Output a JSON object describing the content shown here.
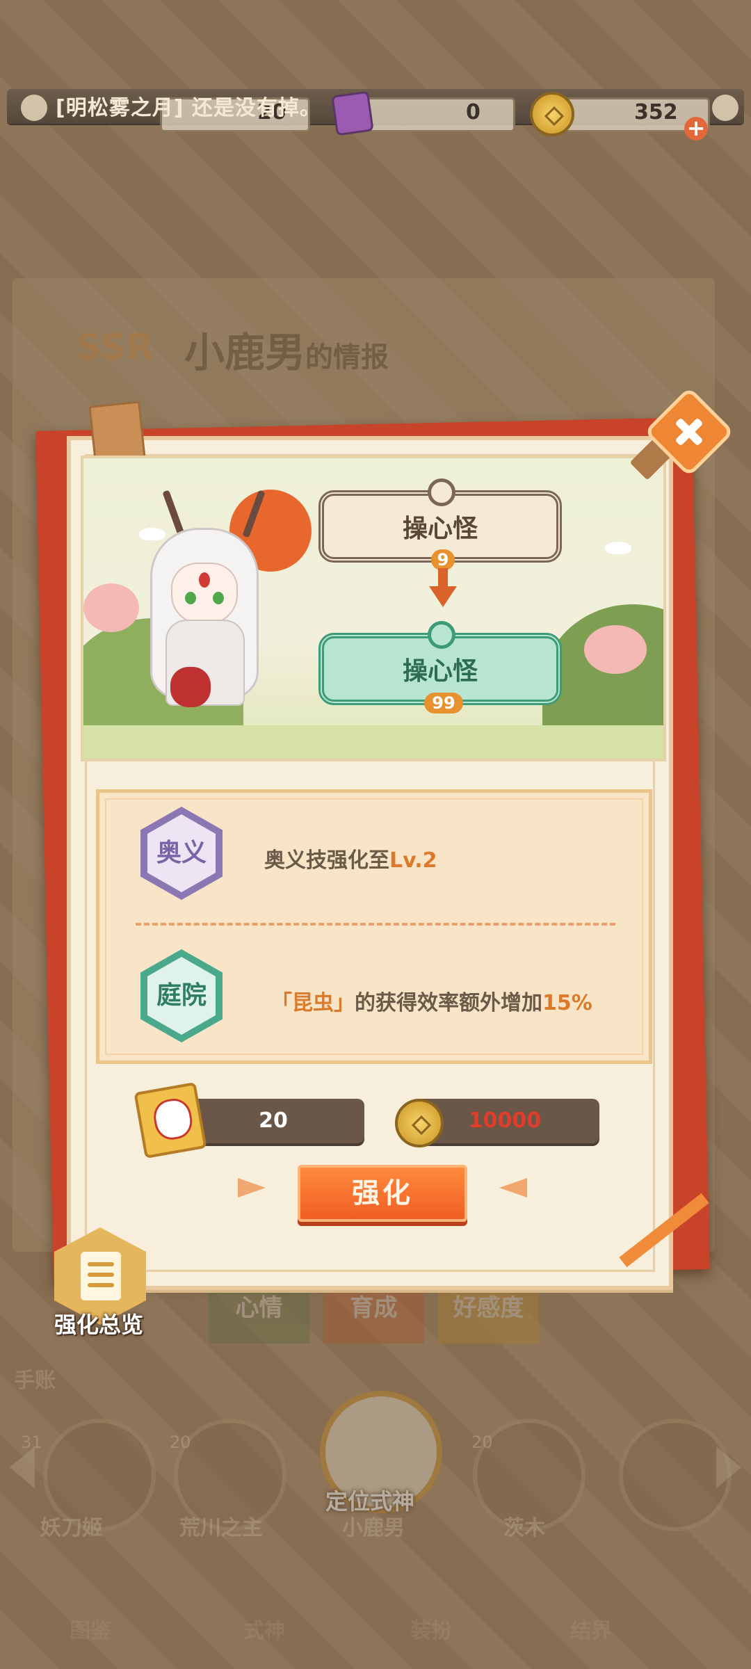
{
  "top_bar": {
    "ticker": "[明松雾之月] 还是没有掉。",
    "tickets": "20",
    "items": "0",
    "coins": "352"
  },
  "background": {
    "title_rank": "SSR",
    "title_name": "小鹿男",
    "title_suffix": "的情报",
    "tabs": [
      "心情",
      "育成",
      "好感度"
    ],
    "left_label": "手账",
    "characters": [
      {
        "level": "31",
        "name": "妖刀姬"
      },
      {
        "level": "20",
        "name": "荒川之主"
      },
      {
        "level": "20",
        "name": "小鹿男"
      },
      {
        "level": "20",
        "name": "茨木"
      }
    ],
    "focus_label": "定位式神",
    "bottom_nav": [
      "图鉴",
      "式神",
      "装扮",
      "结界"
    ]
  },
  "dialog": {
    "from_title": "操心怪",
    "from_level": "9",
    "to_title": "操心怪",
    "to_level": "99",
    "bonus_rows": [
      {
        "badge": "奥义",
        "text": "奥义技强化至",
        "highlight": "Lv.2"
      },
      {
        "badge": "庭院",
        "text_open": "「昆虫」",
        "text": "的获得效率额外增加",
        "highlight": "15%"
      }
    ],
    "cost_tickets": "20",
    "cost_coins": "10000",
    "upgrade_button": "强化",
    "overview_button": "强化总览"
  },
  "colors": {
    "accent_orange": "#ef6a2a",
    "teal": "#3d9b79",
    "purple": "#8a77b3",
    "panel": "#f7eedb",
    "cost_red": "#e23c2a"
  },
  "icons": [
    "close-icon",
    "ticket-icon",
    "coin-icon",
    "document-icon",
    "plus-icon"
  ]
}
